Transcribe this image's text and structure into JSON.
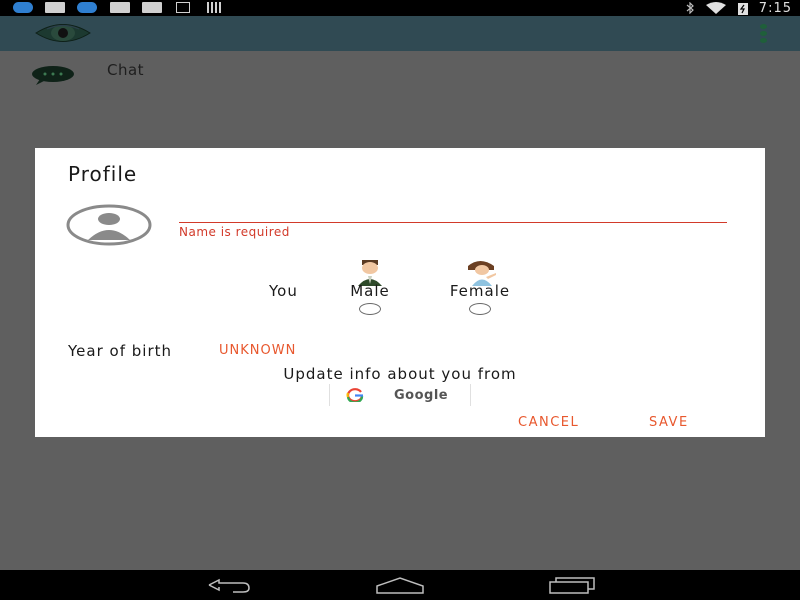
{
  "status_bar": {
    "time": "7:15",
    "left_icons": [
      "app-icon",
      "app-icon",
      "message-icon",
      "message-icon",
      "download-icon",
      "barcode-icon"
    ],
    "right_icons": [
      "bluetooth-icon",
      "wifi-icon",
      "battery-icon"
    ]
  },
  "app_bar": {
    "logo": "eye-logo-icon",
    "menu_icon": "overflow-menu-icon"
  },
  "chat": {
    "label": "Chat",
    "icon": "chat-bubble-icon"
  },
  "dialog": {
    "title": "Profile",
    "avatar_icon": "avatar-placeholder-icon",
    "name_input": {
      "value": "",
      "placeholder": ""
    },
    "name_error": "Name is required",
    "you_label": "You",
    "gender_options": [
      {
        "label": "Male",
        "icon": "male-avatar-icon",
        "selected": false
      },
      {
        "label": "Female",
        "icon": "female-avatar-icon",
        "selected": false
      }
    ],
    "year_of_birth_label": "Year of birth",
    "year_of_birth_value": "UNKNOWN",
    "update_label": "Update info about you from",
    "google_button": {
      "label": "Google",
      "icon": "google-g-icon"
    },
    "cancel_label": "CANCEL",
    "save_label": "SAVE"
  },
  "nav_bar": {
    "buttons": [
      "back-icon",
      "home-icon",
      "recents-icon"
    ]
  },
  "colors": {
    "accent": "#e8582e",
    "error": "#d23a2a",
    "app_bar": "#304a53",
    "scrim_background": "#5f5f5f"
  }
}
